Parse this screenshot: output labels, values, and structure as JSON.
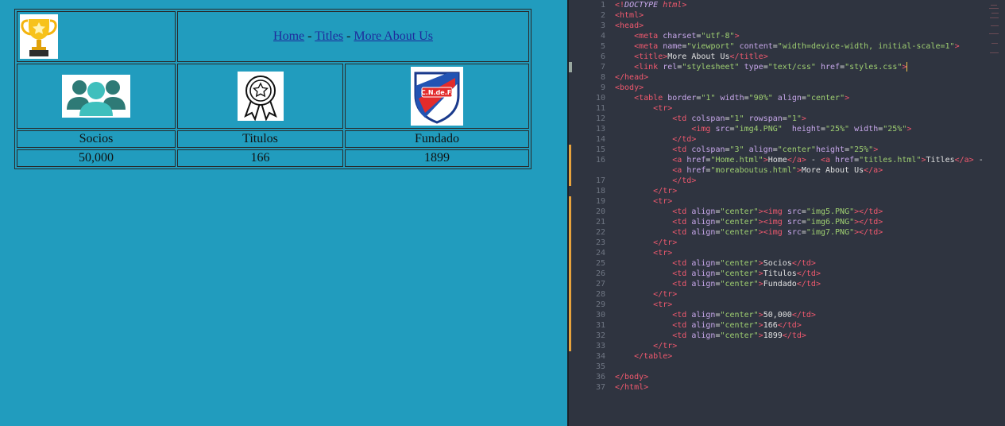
{
  "page": {
    "nav": {
      "home": "Home",
      "sep1": " - ",
      "titles": "Titles",
      "sep2": " - ",
      "about": "More About Us"
    },
    "stats": [
      {
        "label": "Socios",
        "value": "50,000",
        "icon": "members-icon"
      },
      {
        "label": "Titulos",
        "value": "166",
        "icon": "medal-icon"
      },
      {
        "label": "Fundado",
        "value": "1899",
        "icon": "club-crest-icon"
      }
    ]
  },
  "editor": {
    "lines": [
      {
        "n": "1",
        "t": "<!DOCTYPE html>"
      },
      {
        "n": "2",
        "t": "<html>"
      },
      {
        "n": "3",
        "t": "<head>"
      },
      {
        "n": "4",
        "t": "    <meta charset=\"utf-8\">"
      },
      {
        "n": "5",
        "t": "    <meta name=\"viewport\" content=\"width=device-width, initial-scale=1\">"
      },
      {
        "n": "6",
        "t": "    <title>More About Us</title>"
      },
      {
        "n": "7",
        "t": "    <link rel=\"stylesheet\" type=\"text/css\" href=\"styles.css\">"
      },
      {
        "n": "8",
        "t": "</head>"
      },
      {
        "n": "9",
        "t": "<body>"
      },
      {
        "n": "10",
        "t": "    <table border=\"1\" width=\"90%\" align=\"center\">"
      },
      {
        "n": "11",
        "t": "        <tr>"
      },
      {
        "n": "12",
        "t": "            <td colspan=\"1\" rowspan=\"1\">"
      },
      {
        "n": "13",
        "t": "                <img src=\"img4.PNG\"  height=\"25%\" width=\"25%\">"
      },
      {
        "n": "14",
        "t": "            </td>"
      },
      {
        "n": "15",
        "t": "            <td colspan=\"3\" align=\"center\"height=\"25%\">"
      },
      {
        "n": "16",
        "t": "            <a href=\"Home.html\">Home</a> - <a href=\"titles.html\">Titles</a> -"
      },
      {
        "n": "",
        "t": "            <a href=\"moreaboutus.html\">More About Us</a>"
      },
      {
        "n": "17",
        "t": "            </td>"
      },
      {
        "n": "18",
        "t": "        </tr>"
      },
      {
        "n": "19",
        "t": "        <tr>"
      },
      {
        "n": "20",
        "t": "            <td align=\"center\"><img src=\"img5.PNG\"></td>"
      },
      {
        "n": "21",
        "t": "            <td align=\"center\"><img src=\"img6.PNG\"></td>"
      },
      {
        "n": "22",
        "t": "            <td align=\"center\"><img src=\"img7.PNG\"></td>"
      },
      {
        "n": "23",
        "t": "        </tr>"
      },
      {
        "n": "24",
        "t": "        <tr>"
      },
      {
        "n": "25",
        "t": "            <td align=\"center\">Socios</td>"
      },
      {
        "n": "26",
        "t": "            <td align=\"center\">Titulos</td>"
      },
      {
        "n": "27",
        "t": "            <td align=\"center\">Fundado</td>"
      },
      {
        "n": "28",
        "t": "        </tr>"
      },
      {
        "n": "29",
        "t": "        <tr>"
      },
      {
        "n": "30",
        "t": "            <td align=\"center\">50,000</td>"
      },
      {
        "n": "31",
        "t": "            <td align=\"center\">166</td>"
      },
      {
        "n": "32",
        "t": "            <td align=\"center\">1899</td>"
      },
      {
        "n": "33",
        "t": "        </tr>"
      },
      {
        "n": "34",
        "t": "    </table>"
      },
      {
        "n": "35",
        "t": ""
      },
      {
        "n": "36",
        "t": "</body>"
      },
      {
        "n": "37",
        "t": "</html>"
      }
    ]
  }
}
